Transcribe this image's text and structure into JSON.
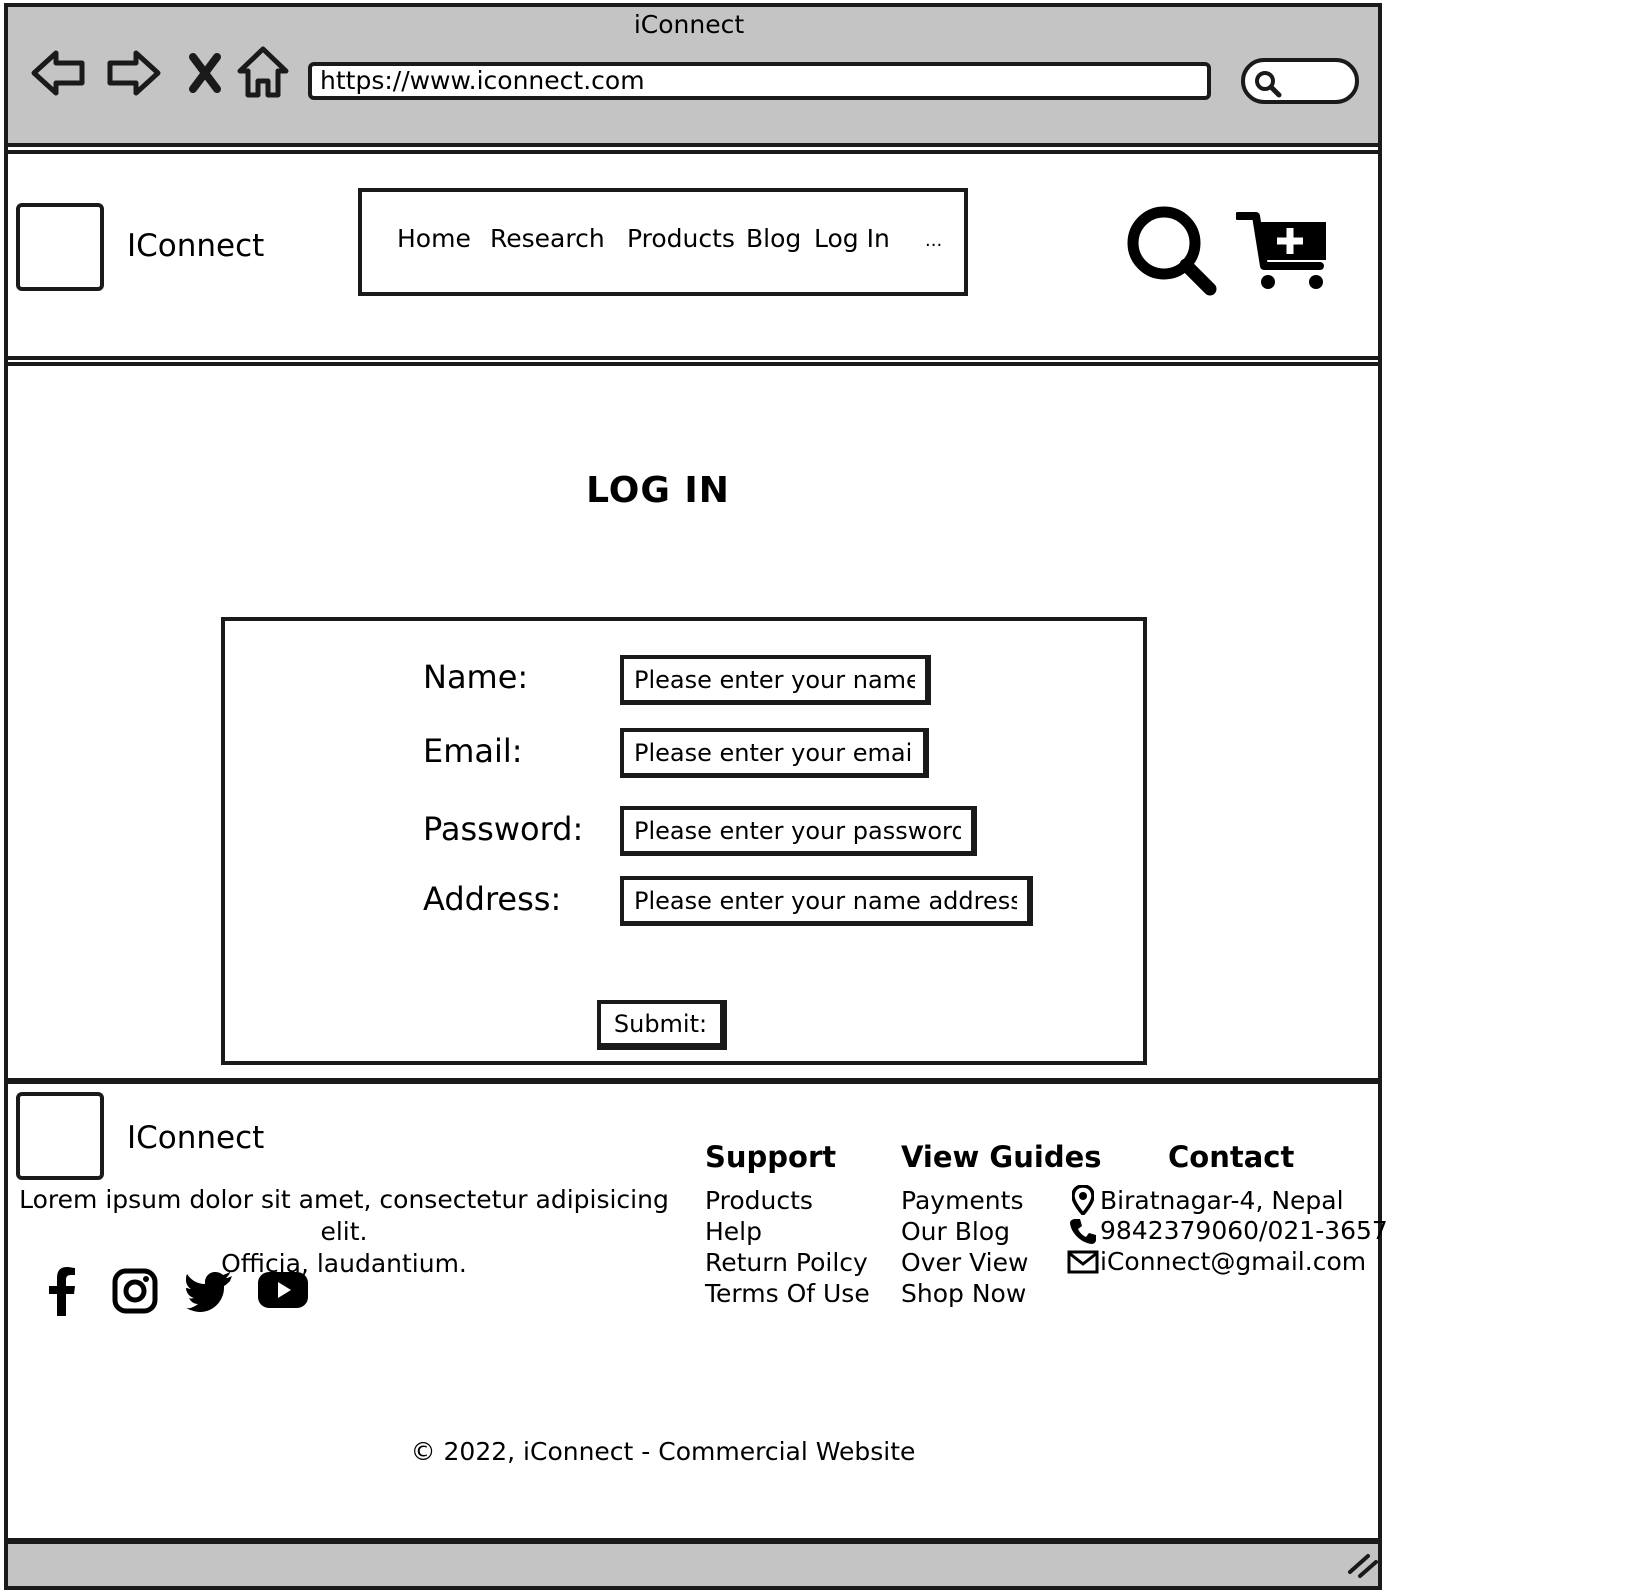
{
  "browser": {
    "title": "iConnect",
    "url": "https://www.iconnect.com",
    "icons": [
      "back-arrow-icon",
      "forward-arrow-icon",
      "close-x-icon",
      "home-icon",
      "search-icon",
      "resize-grip-icon"
    ]
  },
  "header": {
    "brand": "IConnect",
    "nav": [
      "Home",
      "Research",
      "Products",
      "Blog",
      "Log In",
      "..."
    ],
    "icons": [
      "search-icon",
      "cart-add-icon"
    ]
  },
  "login": {
    "title": "LOG IN",
    "fields": [
      {
        "label": "Name:",
        "placeholder": "Please enter your name"
      },
      {
        "label": "Email:",
        "placeholder": "Please enter your email"
      },
      {
        "label": "Password:",
        "placeholder": "Please enter your password"
      },
      {
        "label": "Address:",
        "placeholder": "Please enter your name address"
      }
    ],
    "submit": "Submit:"
  },
  "footer": {
    "brand": "IConnect",
    "description_line1": "Lorem ipsum dolor sit amet, consectetur adipisicing elit.",
    "description_line2": "Officia, laudantium.",
    "social_icons": [
      "facebook-icon",
      "instagram-icon",
      "twitter-icon",
      "youtube-icon"
    ],
    "support": {
      "heading": "Support",
      "links": [
        "Products",
        "Help",
        "Return Poilcy",
        "Terms Of Use"
      ]
    },
    "guides": {
      "heading": "View Guides",
      "links": [
        "Payments",
        "Our Blog",
        "Over View",
        "Shop Now"
      ]
    },
    "contact": {
      "heading": "Contact",
      "address": "Biratnagar-4, Nepal",
      "phone": "9842379060/021-3657",
      "email": "iConnect@gmail.com"
    },
    "copyright": "© 2022, iConnect - Commercial Website"
  },
  "colors": {
    "chrome": "#c4c4c4",
    "ink": "#1a1a1a",
    "background": "#ffffff"
  }
}
